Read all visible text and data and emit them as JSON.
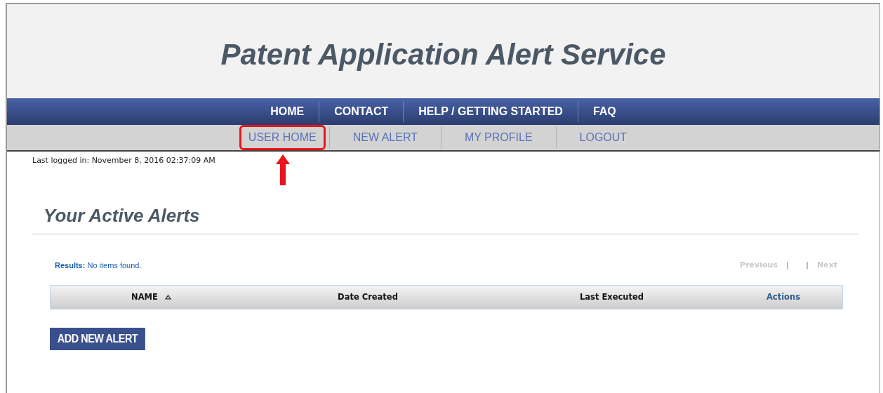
{
  "header": {
    "title": "Patent Application Alert Service"
  },
  "main_nav": [
    {
      "label": "HOME"
    },
    {
      "label": "CONTACT"
    },
    {
      "label": "HELP / GETTING STARTED"
    },
    {
      "label": "FAQ"
    }
  ],
  "user_nav": [
    {
      "label": "USER HOME",
      "highlighted": true
    },
    {
      "label": "NEW ALERT",
      "highlighted": false
    },
    {
      "label": "MY PROFILE",
      "highlighted": false
    },
    {
      "label": "LOGOUT",
      "highlighted": false
    }
  ],
  "last_login": "Last logged in: November 8, 2016 02:37:09 AM",
  "heading": "Your Active Alerts",
  "results": "**Results:** No items found.",
  "pager": {
    "previous": "Previous",
    "separator": "|",
    "next": "Next"
  },
  "table": {
    "columns": [
      {
        "label": "NAME",
        "sorted": true
      },
      {
        "label": "Date Created",
        "sorted": false
      },
      {
        "label": "Last Executed",
        "sorted": false
      },
      {
        "label": "Actions",
        "sorted": false
      }
    ]
  },
  "add_button": "ADD NEW ALERT"
}
